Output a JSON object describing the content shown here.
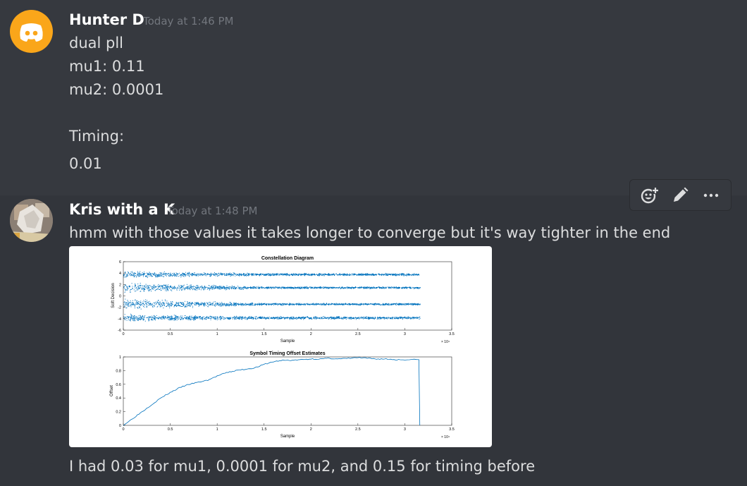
{
  "messages": [
    {
      "author": "Hunter D",
      "timestamp": "Today at 1:46 PM",
      "lines": [
        "dual pll",
        "mu1: 0.11",
        "mu2: 0.0001",
        "Timing:",
        "0.01"
      ]
    },
    {
      "author": "Kris with a K",
      "timestamp": "Today at 1:48 PM",
      "lines": [
        "hmm with those values it takes longer to converge but it's way tighter in the end"
      ]
    },
    {
      "lines": [
        "I had 0.03 for mu1, 0.0001 for mu2, and 0.15 for timing before"
      ]
    }
  ],
  "toolbar": {
    "icons": [
      "add-reaction-icon",
      "edit-pencil-icon",
      "more-options-icon"
    ]
  },
  "colors": {
    "background": "#36393f",
    "hover_background": "#32353b",
    "username": "#ffffff",
    "timestamp": "#72767d",
    "text": "#dcddde",
    "discord_avatar": "#faa61a",
    "plot_blue": "#0072bd"
  },
  "chart_data": [
    {
      "type": "scatter",
      "title": "Constellation Diagram",
      "xlabel": "Sample",
      "ylabel": "Soft Decision",
      "xlim": [
        0,
        35000
      ],
      "ylim": [
        -6,
        6
      ],
      "x_ticks": [
        "0",
        "0.5",
        "1",
        "1.5",
        "2",
        "2.5",
        "3",
        "3.5"
      ],
      "y_ticks": [
        "6",
        "4",
        "2",
        "0",
        "-2",
        "-4",
        "-6"
      ],
      "x_exponent": "× 10⁴",
      "series": [
        {
          "center": 3.8,
          "spread_start": 0.7,
          "spread_end": 0.25
        },
        {
          "center": 1.5,
          "spread_start": 1.1,
          "spread_end": 0.22
        },
        {
          "center": -1.4,
          "spread_start": 1.1,
          "spread_end": 0.22
        },
        {
          "center": -3.8,
          "spread_start": 0.8,
          "spread_end": 0.3
        }
      ],
      "data_end": 31600
    },
    {
      "type": "line",
      "title": "Symbol Timing Offset Estimates",
      "xlabel": "Sample",
      "ylabel": "Offset",
      "xlim": [
        0,
        35000
      ],
      "ylim": [
        0,
        1
      ],
      "x_ticks": [
        "0",
        "0.5",
        "1",
        "1.5",
        "2",
        "2.5",
        "3",
        "3.5"
      ],
      "y_ticks": [
        "1",
        "0.8",
        "0.6",
        "0.4",
        "0.2",
        "0"
      ],
      "x_exponent": "× 10⁴",
      "x": [
        0,
        1000,
        2000,
        3000,
        4000,
        5000,
        6000,
        7000,
        8000,
        9000,
        10000,
        11000,
        12000,
        13000,
        14000,
        15000,
        16000,
        17000,
        18000,
        19000,
        20000,
        21000,
        22000,
        23000,
        24000,
        25000,
        26000,
        27000,
        28000,
        29000,
        30000,
        31500,
        31600
      ],
      "y": [
        0.0,
        0.1,
        0.2,
        0.3,
        0.4,
        0.48,
        0.55,
        0.6,
        0.63,
        0.66,
        0.72,
        0.77,
        0.8,
        0.82,
        0.84,
        0.89,
        0.93,
        0.95,
        0.95,
        0.96,
        0.97,
        0.97,
        0.98,
        0.97,
        0.98,
        0.99,
        0.98,
        0.97,
        0.97,
        0.96,
        0.96,
        0.96,
        0.0
      ]
    }
  ]
}
